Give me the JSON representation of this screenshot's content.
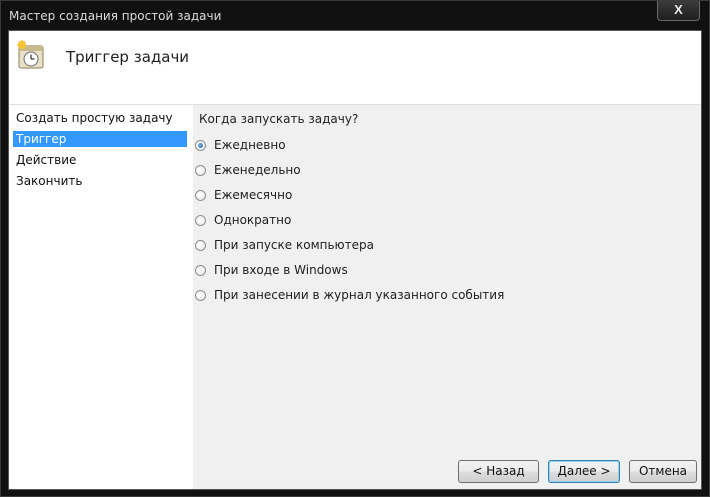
{
  "window": {
    "title": "Мастер создания простой задачи",
    "close_label": "X"
  },
  "header": {
    "title": "Триггер задачи",
    "icon": "task-scheduler-clock-icon"
  },
  "sidebar": {
    "items": [
      {
        "label": "Создать простую задачу",
        "selected": false
      },
      {
        "label": "Триггер",
        "selected": true
      },
      {
        "label": "Действие",
        "selected": false
      },
      {
        "label": "Закончить",
        "selected": false
      }
    ]
  },
  "main": {
    "question": "Когда запускать задачу?",
    "options": [
      {
        "label": "Ежедневно",
        "checked": true
      },
      {
        "label": "Еженедельно",
        "checked": false
      },
      {
        "label": "Ежемесячно",
        "checked": false
      },
      {
        "label": "Однократно",
        "checked": false
      },
      {
        "label": "При запуске компьютера",
        "checked": false
      },
      {
        "label": "При входе в Windows",
        "checked": false
      },
      {
        "label": "При занесении в журнал указанного события",
        "checked": false
      }
    ]
  },
  "buttons": {
    "back": "< Назад",
    "next": "Далее >",
    "cancel": "Отмена"
  }
}
